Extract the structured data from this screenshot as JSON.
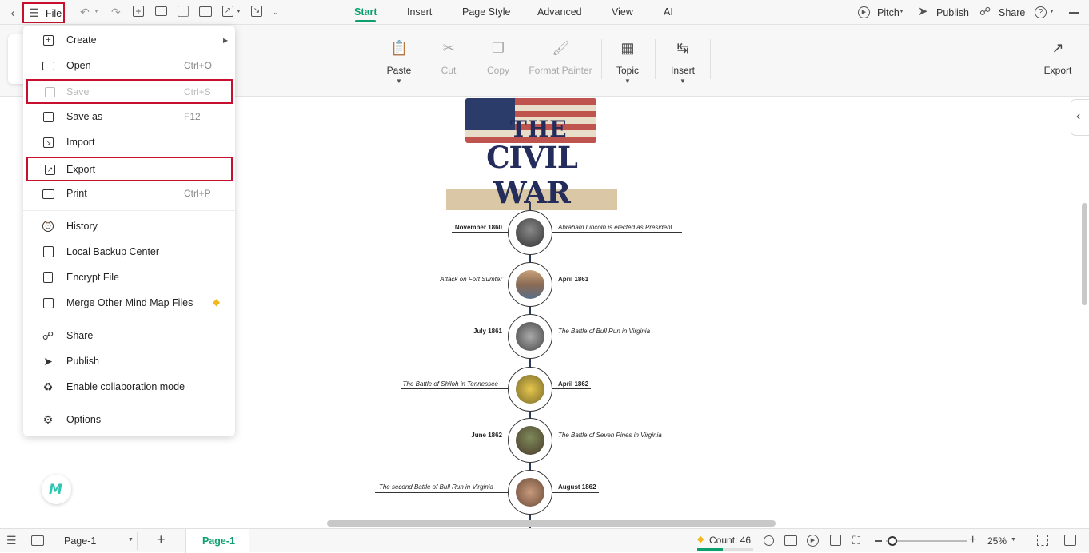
{
  "toolbar": {
    "file_label": "File",
    "tabs": [
      {
        "label": "Start",
        "active": true
      },
      {
        "label": "Insert",
        "active": false
      },
      {
        "label": "Page Style",
        "active": false
      },
      {
        "label": "Advanced",
        "active": false
      },
      {
        "label": "View",
        "active": false
      },
      {
        "label": "AI",
        "active": false
      }
    ],
    "pitch": "Pitch",
    "publish": "Publish",
    "share": "Share"
  },
  "ribbon": {
    "paste": "Paste",
    "cut": "Cut",
    "copy": "Copy",
    "format_painter": "Format Painter",
    "topic": "Topic",
    "insert": "Insert",
    "export": "Export"
  },
  "file_menu": {
    "items": [
      {
        "label": "Create",
        "shortcut": "",
        "icon": "plus-square-icon"
      },
      {
        "label": "Open",
        "shortcut": "Ctrl+O",
        "icon": "folder-icon"
      },
      {
        "label": "Save",
        "shortcut": "Ctrl+S",
        "icon": "save-icon",
        "disabled": true
      },
      {
        "label": "Save as",
        "shortcut": "F12",
        "icon": "save-as-icon"
      },
      {
        "label": "Import",
        "shortcut": "",
        "icon": "import-icon"
      },
      {
        "label": "Export",
        "shortcut": "",
        "icon": "export-icon"
      },
      {
        "label": "Print",
        "shortcut": "Ctrl+P",
        "icon": "print-icon"
      },
      {
        "label": "History",
        "shortcut": "",
        "icon": "history-icon"
      },
      {
        "label": "Local Backup Center",
        "shortcut": "",
        "icon": "backup-icon"
      },
      {
        "label": "Encrypt File",
        "shortcut": "",
        "icon": "lock-file-icon"
      },
      {
        "label": "Merge Other Mind Map Files",
        "shortcut": "",
        "icon": "merge-icon"
      },
      {
        "label": "Share",
        "shortcut": "",
        "icon": "share-icon"
      },
      {
        "label": "Publish",
        "shortcut": "",
        "icon": "publish-icon"
      },
      {
        "label": "Enable collaboration mode",
        "shortcut": "",
        "icon": "collaboration-icon"
      },
      {
        "label": "Options",
        "shortcut": "",
        "icon": "gear-icon"
      }
    ]
  },
  "canvas": {
    "banner_line1": "THE",
    "banner_line2": "CIVIL WAR",
    "events": [
      {
        "date": "November 1860",
        "event": "Abraham Lincoln is elected as President"
      },
      {
        "date": "April 1861",
        "event": "Attack on Fort Sumter"
      },
      {
        "date": "July 1861",
        "event": "The Battle of Bull Run in Virginia"
      },
      {
        "date": "April 1862",
        "event": "The Battle of Shiloh in Tennessee"
      },
      {
        "date": "June 1862",
        "event": "The Battle of Seven Pines in Virginia"
      },
      {
        "date": "August 1862",
        "event": "The second Battle of Bull Run in Virginia"
      }
    ]
  },
  "statusbar": {
    "page_select": "Page-1",
    "page_tab": "Page-1",
    "count": "Count: 46",
    "zoom": "25%"
  },
  "colors": {
    "accent": "#0d9f6e",
    "highlight": "#c8102e"
  }
}
